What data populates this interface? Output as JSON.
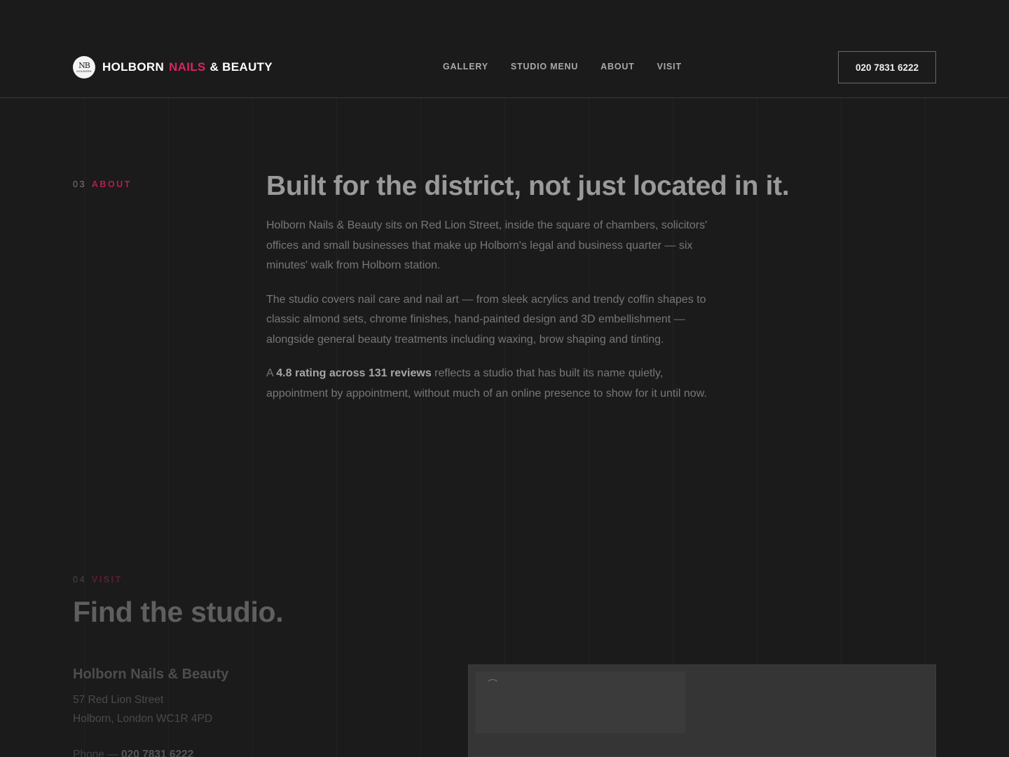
{
  "header": {
    "brand": {
      "first": "HOLBORN",
      "accent": "NAILS",
      "rest": "& BEAUTY"
    },
    "logo_monogram": "NB",
    "logo_sub": "HOLBORN",
    "nav": [
      "GALLERY",
      "STUDIO MENU",
      "ABOUT",
      "VISIT"
    ],
    "phone_button": "020 7831 6222"
  },
  "about": {
    "number": "03",
    "label": "ABOUT",
    "title": "Built for the district, not just located in it.",
    "paragraph1": "Holborn Nails & Beauty sits on Red Lion Street, inside the square of chambers, solicitors' offices and small businesses that make up Holborn's legal and business quarter — six minutes' walk from Holborn station.",
    "paragraph2": "The studio covers nail care and nail art — from sleek acrylics and trendy coffin shapes to classic almond sets, chrome finishes, hand-painted design and 3D embellishment — alongside general beauty treatments including waxing, brow shaping and tinting.",
    "paragraph3_pre": "A",
    "paragraph3_strong": "4.8 rating across 131 reviews",
    "paragraph3_post": "reflects a studio that has built its name quietly, appointment by appointment, without much of an online presence to show for it until now."
  },
  "visit": {
    "number": "04",
    "label": "VISIT",
    "title": "Find the studio.",
    "studio_name": "Holborn Nails & Beauty",
    "address_line1": "57 Red Lion Street",
    "address_line2": "Holborn, London WC1R 4PD",
    "phone_label": "Phone —",
    "phone_value": "020 7831 6222"
  },
  "colors": {
    "background": "#1b1b1b",
    "accent": "#d7265e",
    "text": "#e8e8e8"
  }
}
